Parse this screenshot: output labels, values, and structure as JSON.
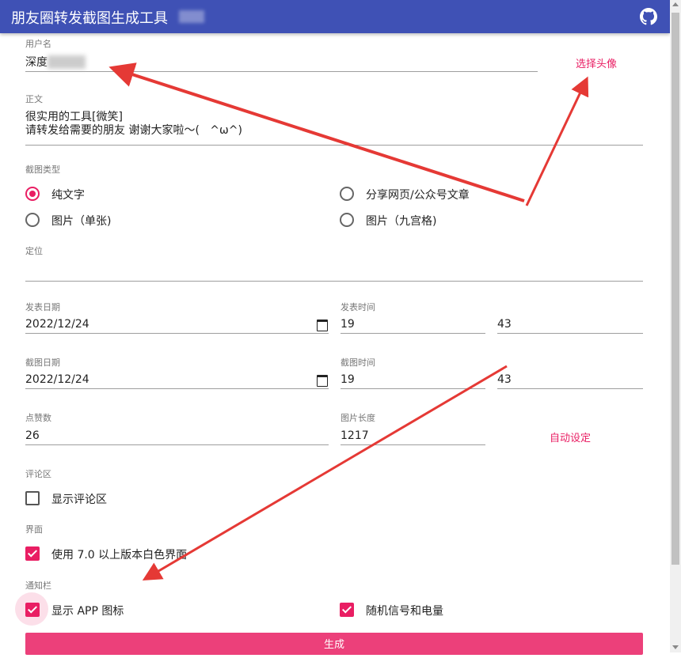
{
  "app": {
    "title": "朋友圈转发截图生成工具"
  },
  "username": {
    "label": "用户名",
    "value": "深度",
    "choose_avatar": "选择头像"
  },
  "body": {
    "label": "正文",
    "lines": [
      "很实用的工具[微笑]",
      "请转发给需要的朋友 谢谢大家啦～(   ^ω^)"
    ]
  },
  "screenshot_type": {
    "label": "截图类型",
    "options": [
      {
        "label": "纯文字",
        "checked": true
      },
      {
        "label": "分享网页/公众号文章",
        "checked": false
      },
      {
        "label": "图片（单张)",
        "checked": false
      },
      {
        "label": "图片（九宫格)",
        "checked": false
      }
    ]
  },
  "location": {
    "label": "定位",
    "value": ""
  },
  "post_date": {
    "label": "发表日期",
    "value": "2022/12/24"
  },
  "post_time": {
    "label": "发表时间",
    "hour": "19",
    "minute": "43"
  },
  "shot_date": {
    "label": "截图日期",
    "value": "2022/12/24"
  },
  "shot_time": {
    "label": "截图时间",
    "hour": "19",
    "minute": "43"
  },
  "likes": {
    "label": "点赞数",
    "value": "26"
  },
  "image_length": {
    "label": "图片长度",
    "value": "1217",
    "auto_label": "自动设定"
  },
  "comments": {
    "label": "评论区",
    "show_label": "显示评论区",
    "checked": false
  },
  "ui": {
    "label": "界面",
    "white_label": "使用 7.0 以上版本白色界面",
    "checked": true
  },
  "notification": {
    "label": "通知栏",
    "show_app_icon": {
      "label": "显示 APP 图标",
      "checked": true
    },
    "random_signal": {
      "label": "随机信号和电量",
      "checked": true
    }
  },
  "generate": {
    "label": "生成"
  },
  "colors": {
    "appbar": "#3f51b5",
    "accent": "#e91e63",
    "arrow": "#e53935"
  }
}
